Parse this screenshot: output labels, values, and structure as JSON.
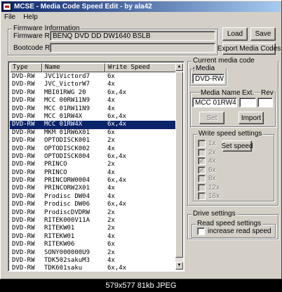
{
  "window": {
    "title": "MCSE - Media Code Speed Edit - by ala42"
  },
  "menu": {
    "file": "File",
    "help": "Help"
  },
  "firmware": {
    "group_label": "Firmware Information",
    "rev_label": "Firmware Rev.",
    "rev_value": "BENQ    DVD DD DW1640   BSLB",
    "bootcode_label": "Bootcode Rev.",
    "bootcode_value": ""
  },
  "buttons": {
    "load": "Load",
    "save": "Save",
    "export": "Export Media Codes",
    "set": "Set",
    "import": "Import",
    "set_speed": "Set speed"
  },
  "table": {
    "headers": [
      "Type",
      "Name",
      "Write Speed"
    ],
    "selected_index": 6,
    "rows": [
      [
        "DVD-RW",
        "JVC1Victord7",
        "6x"
      ],
      [
        "DVD-RW",
        "JVC_VictorW7",
        "4x"
      ],
      [
        "DVD-RW",
        "MBI01RWG 20",
        "6x,4x"
      ],
      [
        "DVD-RW",
        "MCC 00RW11N9",
        "4x"
      ],
      [
        "DVD-RW",
        "MCC 01RW11N9",
        "4x"
      ],
      [
        "DVD-RW",
        "MCC 01RW4X",
        "6x,4x"
      ],
      [
        "DVD-RW",
        "MCC 01RW4X",
        "6x,4x"
      ],
      [
        "DVD-RW",
        "MKM 01RW6X01",
        "6x"
      ],
      [
        "DVD-RW",
        "OPTODISCK001",
        "2x"
      ],
      [
        "DVD-RW",
        "OPTODISCK002",
        "4x"
      ],
      [
        "DVD-RW",
        "OPTODISCK004",
        "6x,4x"
      ],
      [
        "DVD-RW",
        "PRINCO",
        "2x"
      ],
      [
        "DVD-RW",
        "PRINCO",
        "4x"
      ],
      [
        "DVD-RW",
        "PRINCORW0004",
        "6x,4x"
      ],
      [
        "DVD-RW",
        "PRINCORW2X01",
        "4x"
      ],
      [
        "DVD-RW",
        "Prodisc DW04",
        "4x"
      ],
      [
        "DVD-RW",
        "Prodisc DW06",
        "6x,4x"
      ],
      [
        "DVD-RW",
        "ProdiscDVDRW",
        "2x"
      ],
      [
        "DVD-RW",
        "RITEK000V11A",
        "2x"
      ],
      [
        "DVD-RW",
        "RITEKW01",
        "2x"
      ],
      [
        "DVD-RW",
        "RITEKW01",
        "4x"
      ],
      [
        "DVD-RW",
        "RITEKW06",
        "6x"
      ],
      [
        "DVD-RW",
        "SONY000000U9",
        "2x"
      ],
      [
        "DVD-RW",
        "TDK502sakuM3",
        "4x"
      ],
      [
        "DVD-RW",
        "TDK601saku",
        "6x,4x"
      ],
      [
        "DVD-RW",
        "TDK701saku",
        "6x"
      ]
    ]
  },
  "current": {
    "group_label": "Current media code setting",
    "media_type_label": "Media type",
    "media_type_value": "DVD-RW",
    "media_name_label": "Media Name",
    "ext_label": "Ext.",
    "rev_label": "Rev",
    "media_name_value": "MCC 01RW4X"
  },
  "write_speed": {
    "group_label": "Write speed settings",
    "items": [
      {
        "label": "1x",
        "checked": false
      },
      {
        "label": "2x",
        "checked": false
      },
      {
        "label": "4x",
        "checked": true
      },
      {
        "label": "6x",
        "checked": true
      },
      {
        "label": "8x",
        "checked": false
      },
      {
        "label": "12x",
        "checked": false
      },
      {
        "label": "16x",
        "checked": false
      }
    ]
  },
  "drive": {
    "group_label": "Drive settings",
    "read_group_label": "Read speed settings",
    "increase_label": "increase read speed"
  },
  "caption": {
    "text": "579x577  81kb  JPEG"
  }
}
